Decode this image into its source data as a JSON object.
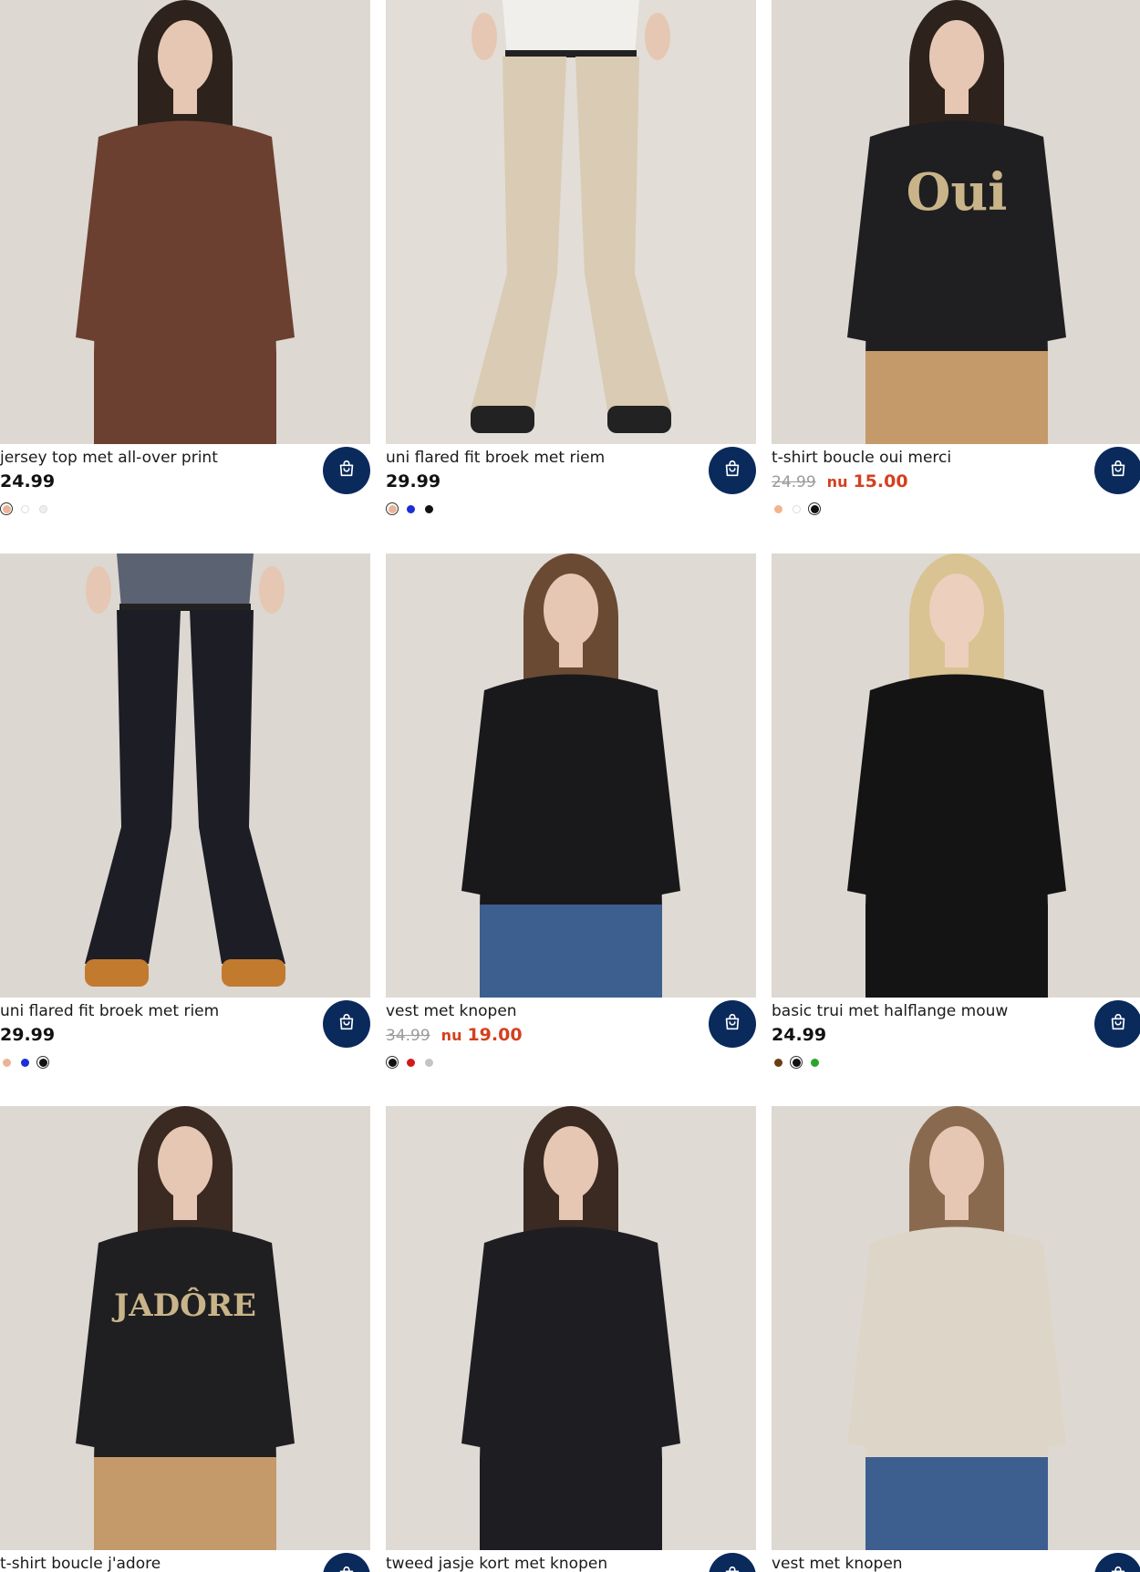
{
  "products": [
    {
      "name": "jersey top met all-over print",
      "price": "24.99",
      "old_price": "",
      "sale_prefix": "",
      "sale_price": "",
      "swatches": [
        {
          "color": "#e9b596",
          "selected": true
        },
        {
          "color": "#ffffff",
          "selected": false
        },
        {
          "color": "#eeeeee",
          "selected": false
        }
      ],
      "photo": {
        "bg": "#ddd8d2",
        "garment": "#6b4030",
        "lower": "#6b4030",
        "skin": "#e6c7b3",
        "hair": "#2d221c",
        "shoes": ""
      }
    },
    {
      "name": "uni flared fit broek met riem",
      "price": "29.99",
      "old_price": "",
      "sale_prefix": "",
      "sale_price": "",
      "swatches": [
        {
          "color": "#e9b596",
          "selected": true
        },
        {
          "color": "#1a2fd6",
          "selected": false
        },
        {
          "color": "#111111",
          "selected": false
        }
      ],
      "photo": {
        "bg": "#e2ddd6",
        "garment": "#f1efec",
        "lower": "#d9cbb4",
        "skin": "#e6c7b3",
        "hair": "",
        "shoes": "#222222"
      }
    },
    {
      "name": "t-shirt boucle oui merci",
      "price": "",
      "old_price": "24.99",
      "sale_prefix": "nu",
      "sale_price": "15.00",
      "swatches": [
        {
          "color": "#f2b48f",
          "selected": false
        },
        {
          "color": "#ffffff",
          "selected": false
        },
        {
          "color": "#111111",
          "selected": true
        }
      ],
      "photo": {
        "bg": "#ddd8d2",
        "garment": "#1f1f22",
        "lower": "#c49a6a",
        "skin": "#e6c7b3",
        "hair": "#2d221c",
        "shoes": "",
        "print": "Oui"
      }
    },
    {
      "name": "uni flared fit broek met riem",
      "price": "29.99",
      "old_price": "",
      "sale_prefix": "",
      "sale_price": "",
      "swatches": [
        {
          "color": "#e9b596",
          "selected": false
        },
        {
          "color": "#1a2fd6",
          "selected": false
        },
        {
          "color": "#111111",
          "selected": true
        }
      ],
      "photo": {
        "bg": "#dcd7d1",
        "garment": "#5b6272",
        "lower": "#1d1d26",
        "skin": "#e6c7b3",
        "hair": "",
        "shoes": "#c27a2e"
      }
    },
    {
      "name": "vest met knopen",
      "price": "",
      "old_price": "34.99",
      "sale_prefix": "nu",
      "sale_price": "19.00",
      "swatches": [
        {
          "color": "#111111",
          "selected": true
        },
        {
          "color": "#d11b1b",
          "selected": false
        },
        {
          "color": "#c4c4c4",
          "selected": false
        }
      ],
      "photo": {
        "bg": "#dfdad4",
        "garment": "#19191c",
        "lower": "#3c5f8f",
        "skin": "#e6c7b3",
        "hair": "#6a4a33",
        "shoes": ""
      }
    },
    {
      "name": "basic trui met halflange mouw",
      "price": "24.99",
      "old_price": "",
      "sale_prefix": "",
      "sale_price": "",
      "swatches": [
        {
          "color": "#6b3e12",
          "selected": false
        },
        {
          "color": "#111111",
          "selected": true
        },
        {
          "color": "#2aa62a",
          "selected": false
        }
      ],
      "photo": {
        "bg": "#ddd8d2",
        "garment": "#141414",
        "lower": "#141414",
        "skin": "#ecd0bd",
        "hair": "#d9c392",
        "shoes": ""
      }
    },
    {
      "name": "t-shirt boucle j'adore",
      "price": "",
      "old_price": "",
      "sale_prefix": "",
      "sale_price": "",
      "swatches": [],
      "photo": {
        "bg": "#ddd8d2",
        "garment": "#1f1f22",
        "lower": "#c49a6a",
        "skin": "#e6c7b3",
        "hair": "#3a2a22",
        "shoes": "",
        "print": "JADÔRE"
      }
    },
    {
      "name": "tweed jasje kort met knopen",
      "price": "",
      "old_price": "",
      "sale_prefix": "",
      "sale_price": "",
      "swatches": [],
      "photo": {
        "bg": "#dfdad4",
        "garment": "#1e1e22",
        "lower": "#1e1e22",
        "skin": "#e6c7b3",
        "hair": "#3a2a22",
        "shoes": ""
      }
    },
    {
      "name": "vest met knopen",
      "price": "",
      "old_price": "",
      "sale_prefix": "",
      "sale_price": "",
      "swatches": [],
      "photo": {
        "bg": "#ddd8d2",
        "garment": "#ddd6c8",
        "lower": "#3c5f8f",
        "skin": "#e6c7b3",
        "hair": "#8a6a4f",
        "shoes": ""
      }
    }
  ],
  "icons": {
    "cart": "shopping-bag-icon"
  },
  "colors": {
    "cart_button": "#0a2a5c",
    "sale": "#d4401f",
    "old_price": "#9b9b9b"
  }
}
